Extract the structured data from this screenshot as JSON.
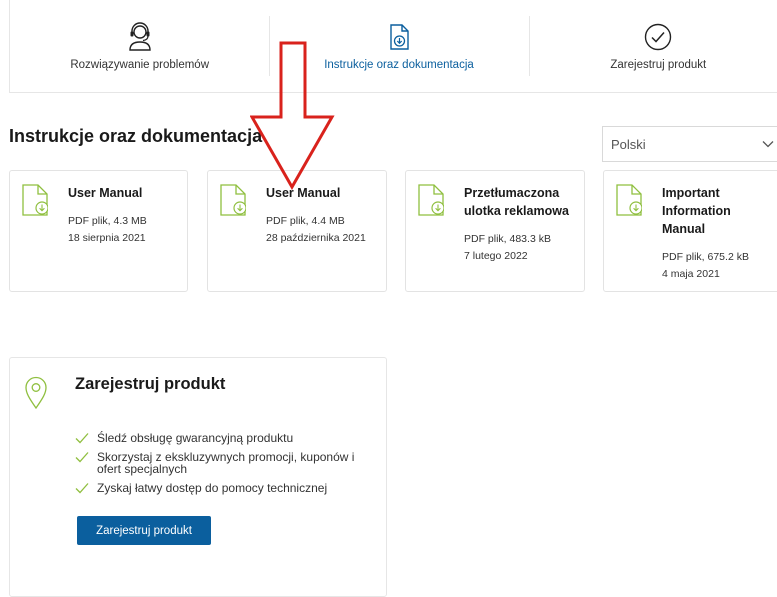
{
  "tabs": [
    {
      "label": "Rozwiązywanie problemów",
      "icon": "headset-support-icon"
    },
    {
      "label": "Instrukcje oraz dokumentacja",
      "icon": "document-download-icon"
    },
    {
      "label": "Zarejestruj produkt",
      "icon": "check-circle-icon"
    }
  ],
  "section": {
    "title": "Instrukcje oraz dokumentacja",
    "language": "Polski"
  },
  "documents": [
    {
      "title": "User Manual",
      "meta": "PDF plik, 4.3 MB",
      "date": "18 sierpnia 2021"
    },
    {
      "title": "User Manual",
      "meta": "PDF plik, 4.4 MB",
      "date": "28 października 2021"
    },
    {
      "title": "Przetłumaczona ulotka reklamowa",
      "meta": "PDF plik, 483.3 kB",
      "date": "7 lutego 2022"
    },
    {
      "title": "Important Information Manual",
      "meta": "PDF plik, 675.2 kB",
      "date": "4 maja 2021"
    }
  ],
  "register": {
    "title": "Zarejestruj produkt",
    "benefits": [
      "Śledź obsługę gwarancyjną produktu",
      "Skorzystaj z ekskluzywnych promocji, kuponów i ofert specjalnych",
      "Zyskaj łatwy dostęp do pomocy technicznej"
    ],
    "button_label": "Zarejestruj produkt"
  },
  "colors": {
    "accent_blue": "#0b5f9e",
    "icon_green": "#8fbf3f",
    "arrow_red": "#d9221c"
  }
}
